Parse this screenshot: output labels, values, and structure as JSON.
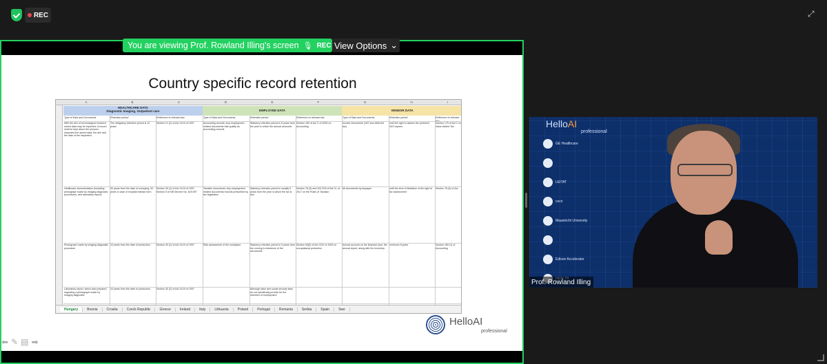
{
  "top": {
    "rec_label": "REC"
  },
  "share": {
    "banner_text": "You are viewing Prof. Rowland Illing's screen",
    "banner_rec": "REC",
    "view_options": "View Options"
  },
  "slide": {
    "title": "Country specific record retention",
    "sheet": {
      "columns": [
        "A",
        "B",
        "C",
        "D",
        "E",
        "F",
        "G",
        "H",
        "I"
      ],
      "bands": [
        {
          "label": "HEALTHCARE DATA",
          "sub": "Diagnostic Imaging, Outpatient care",
          "color": "#bcd0ee"
        },
        {
          "label": "EMPLOYEE DATA",
          "color": "#cfe3b8"
        },
        {
          "label": "VENDOR DATA",
          "color": "#f6e3a6"
        }
      ],
      "col_headers": [
        "Type of Data and Documents",
        "Retention period",
        "Reference to relevant law",
        "Type of Data and Documents",
        "Retention period",
        "Reference to relevant law",
        "Type of Data and Documents",
        "Retention period",
        "Reference to relevant law"
      ],
      "rows": [
        [
          "With the aim of technological research, stored data may be expected. A record shall be kept about the persons inspected the stored data, the aim and the date of the inspection.",
          "The obligatory retention period is 10 years",
          "Section 21 (2) of Act XLVII of 1997",
          "Accounting records: Any employment-related documents that qualify as accounting records",
          "Statutory retention period is 8 years from the year to which the annual accounts",
          "Section 169 of Act C of 2000 on Accounting",
          "Invoice documents (VAT and deferred tax)",
          "until the right to assess the pertinent VAT expires",
          "Section 179 of Act C on Value Added Tax"
        ],
        [
          "Healthcare documentation (including: photograph made by imaging diagnostic procedures, and laboratory report)",
          "30 years from the date of surveying. 50 years in case of hospital release form",
          "Section 30 (1) of Act XLVII of 1997, Section 5 of NM Decree No. 62/1997",
          "Taxation documents: Any employment-related documents records prescribed by tax legislation",
          "Statutory retention period is usually 5 years from the year in which the tax is due",
          "Section 78 (3) and 202-203 of Act CL of 2017 on the Rules of Taxation",
          "All documents by taxpayer",
          "until the term of limitation of the right of tax assessment",
          "Section 78 (3) of Act"
        ],
        [
          "Photograph made by imaging diagnostic procedure",
          "10 years from the date of production.",
          "Section 30 (2) of Act XLVII of 1997",
          "Risk assessment of the workplace",
          "Statutory retention period is 5 years from the coming to existence of the documents",
          "Section 54(5) of Act XCIII of 1993 on occupational protection",
          "Annual account on the financial year, the annual report, along with the inventory",
          "minimum 8 years",
          "Section 169 (1) of Accounting"
        ],
        [
          "Laboratory report, which was prepared regarding a photograph made by imaging diagnostic",
          "10 years from the date of production.",
          "Section 30 (2) of Act XLVII of 1997",
          "",
          "Although labor and social security laws do not specifically provide for the retention of employment",
          "",
          "",
          "",
          ""
        ]
      ],
      "tabs": [
        "Hungary",
        "Bosnia",
        "Croatia",
        "Czeck Republic",
        "Greece",
        "Ireland",
        "Italy",
        "Lithuania",
        "Poland",
        "Portugal",
        "Romania",
        "Serbia",
        "Spain",
        "Swe"
      ],
      "active_tab": "Hungary"
    },
    "brand": {
      "name": "HelloAI",
      "sub": "professional"
    }
  },
  "video": {
    "backdrop_brand_a": "Hello",
    "backdrop_brand_b": "AI",
    "backdrop_sub": "professional",
    "logos": [
      "GE Healthcare",
      "",
      "LEITAT",
      "cocir",
      "Maastricht University",
      "",
      "Edison Accelerator",
      "HEALTH"
    ],
    "participant_name": "Prof. Rowland Illing"
  },
  "icons": [
    "shield-check-icon",
    "record-dot-icon",
    "expand-icon",
    "microphone-icon",
    "chevron-down-icon",
    "arrow-left-icon",
    "pen-icon",
    "presenter-icon",
    "arrow-right-icon"
  ]
}
